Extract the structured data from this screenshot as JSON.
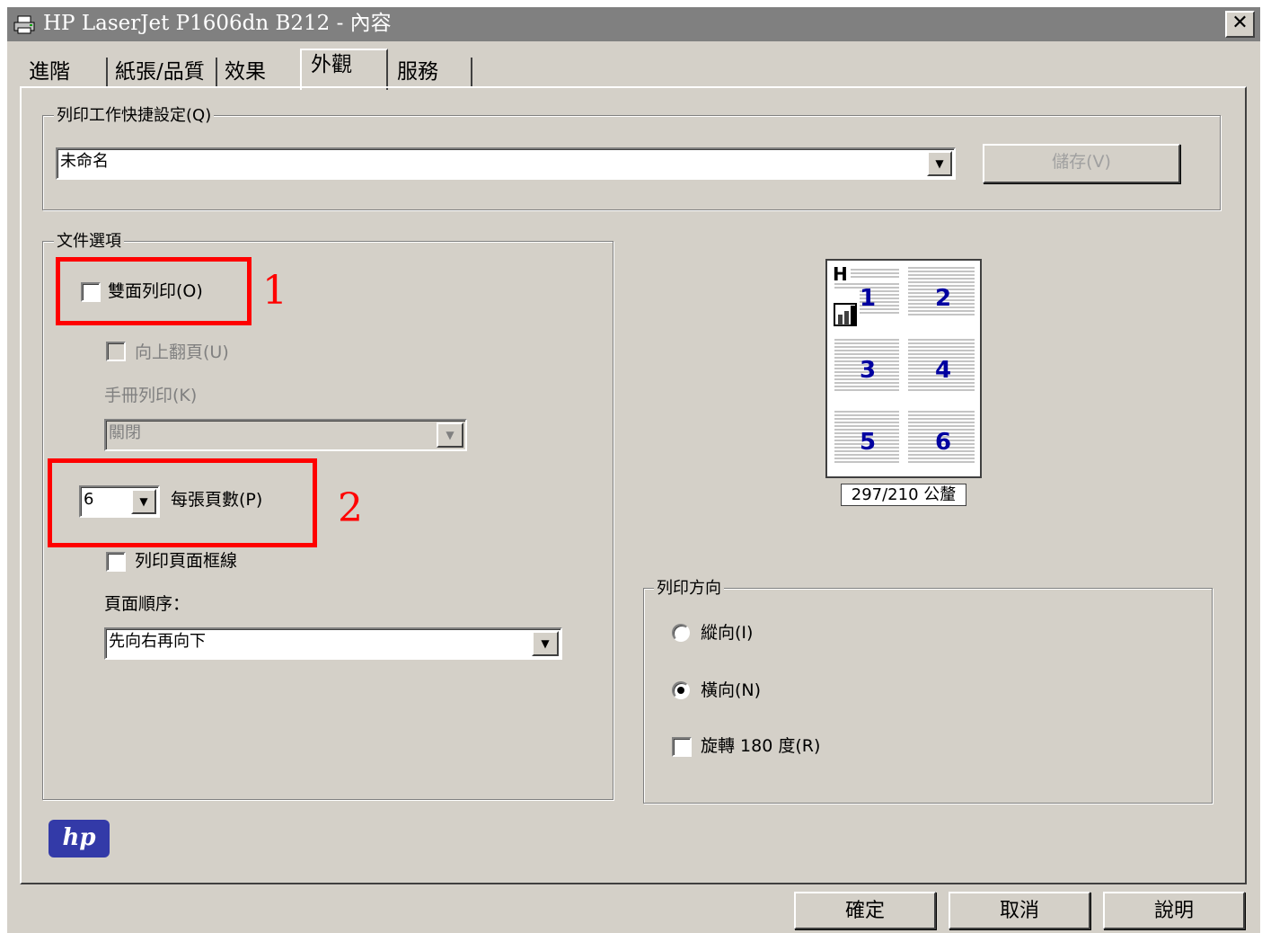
{
  "window": {
    "title": "HP LaserJet P1606dn B212 - 內容",
    "close_glyph": "✕"
  },
  "tabs": [
    {
      "label": "進階"
    },
    {
      "label": "紙張/品質"
    },
    {
      "label": "效果"
    },
    {
      "label": "外觀",
      "active": true
    },
    {
      "label": "服務"
    }
  ],
  "quick_settings": {
    "legend": "列印工作快捷設定(Q)",
    "value": "未命名",
    "save_label": "儲存(V)"
  },
  "document_options": {
    "legend": "文件選項",
    "duplex_label": "雙面列印(O)",
    "flip_up_label": "向上翻頁(U)",
    "booklet_label": "手冊列印(K)",
    "booklet_value": "關閉",
    "pages_per_sheet_value": "6",
    "pages_per_sheet_label": "每張頁數(P)",
    "print_borders_label": "列印頁面框線",
    "page_order_label": "頁面順序：",
    "page_order_value": "先向右再向下"
  },
  "annotations": {
    "marker_1": "1",
    "marker_2": "2"
  },
  "preview": {
    "header_letter": "H",
    "page_numbers": [
      "1",
      "2",
      "3",
      "4",
      "5",
      "6"
    ],
    "size_caption": "297/210 公釐"
  },
  "orientation": {
    "legend": "列印方向",
    "portrait_label": "縱向(I)",
    "landscape_label": "橫向(N)",
    "rotate_label": "旋轉 180 度(R)",
    "selected": "landscape"
  },
  "footer": {
    "ok_label": "確定",
    "cancel_label": "取消",
    "help_label": "說明"
  },
  "branding": {
    "logo_text": "hp"
  },
  "colors": {
    "annotation": "#ff0000",
    "page_number": "#0000a0",
    "titlebar": "#808080",
    "logo": "#333aa8"
  }
}
